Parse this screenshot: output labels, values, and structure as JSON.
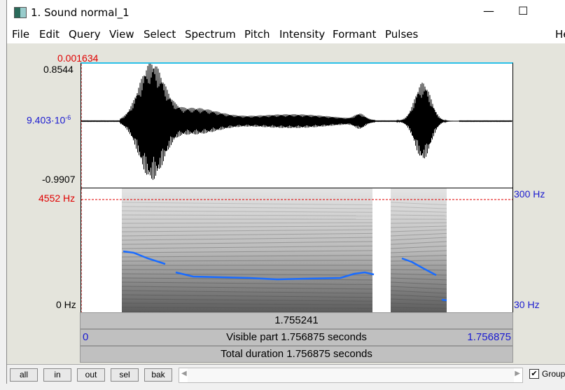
{
  "window": {
    "title": "1. Sound normal_1",
    "minimize": "—",
    "maximize": "☐",
    "close": "✕"
  },
  "menu": [
    "File",
    "Edit",
    "Query",
    "View",
    "Select",
    "Spectrum",
    "Pitch",
    "Intensity",
    "Formant",
    "Pulses",
    "He"
  ],
  "waveform": {
    "cursor_value": "0.001634",
    "max": "0.8544",
    "mid": "9.403·10",
    "mid_exp": "-6",
    "min": "-0.9907"
  },
  "spectrogram": {
    "cursor_freq": "4552 Hz",
    "bottom_freq": "0 Hz",
    "pitch_top": "300 Hz",
    "pitch_bottom": "30 Hz"
  },
  "bars": {
    "cursor_time": "1.755241",
    "visible_start": "0",
    "visible": "Visible part 1.756875 seconds",
    "visible_end": "1.756875",
    "total": "Total duration 1.756875 seconds"
  },
  "toolbar": {
    "all": "all",
    "in": "in",
    "out": "out",
    "sel": "sel",
    "bak": "bak",
    "group": "Group",
    "group_checked": true
  },
  "colors": {
    "cursor": "#e00000",
    "axis_blue": "#1a1ad0",
    "pitch": "#1a6cff"
  }
}
